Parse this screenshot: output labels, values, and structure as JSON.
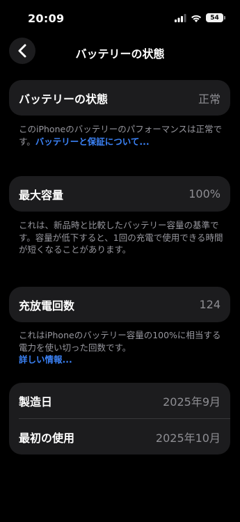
{
  "status_bar": {
    "time": "20:09",
    "battery_level": "54"
  },
  "nav": {
    "title": "バッテリーの状態"
  },
  "health": {
    "label": "バッテリーの状態",
    "value": "正常",
    "note": "このiPhoneのバッテリーのパフォーマンスは正常です。",
    "link": "バッテリーと保証について..."
  },
  "capacity": {
    "label": "最大容量",
    "value": "100%",
    "note": "これは、新品時と比較したバッテリー容量の基準です。容量が低下すると、1回の充電で使用できる時間が短くなることがあります。"
  },
  "cycles": {
    "label": "充放電回数",
    "value": "124",
    "note": "これはiPhoneのバッテリー容量の100%に相当する電力を使い切った回数です。",
    "link": "詳しい情報..."
  },
  "dates": {
    "manufactured_label": "製造日",
    "manufactured_value": "2025年9月",
    "first_use_label": "最初の使用",
    "first_use_value": "2025年10月"
  },
  "colors": {
    "background": "#000000",
    "card": "#1c1c1e",
    "link": "#3b82f6",
    "secondary_text": "#98989f"
  }
}
